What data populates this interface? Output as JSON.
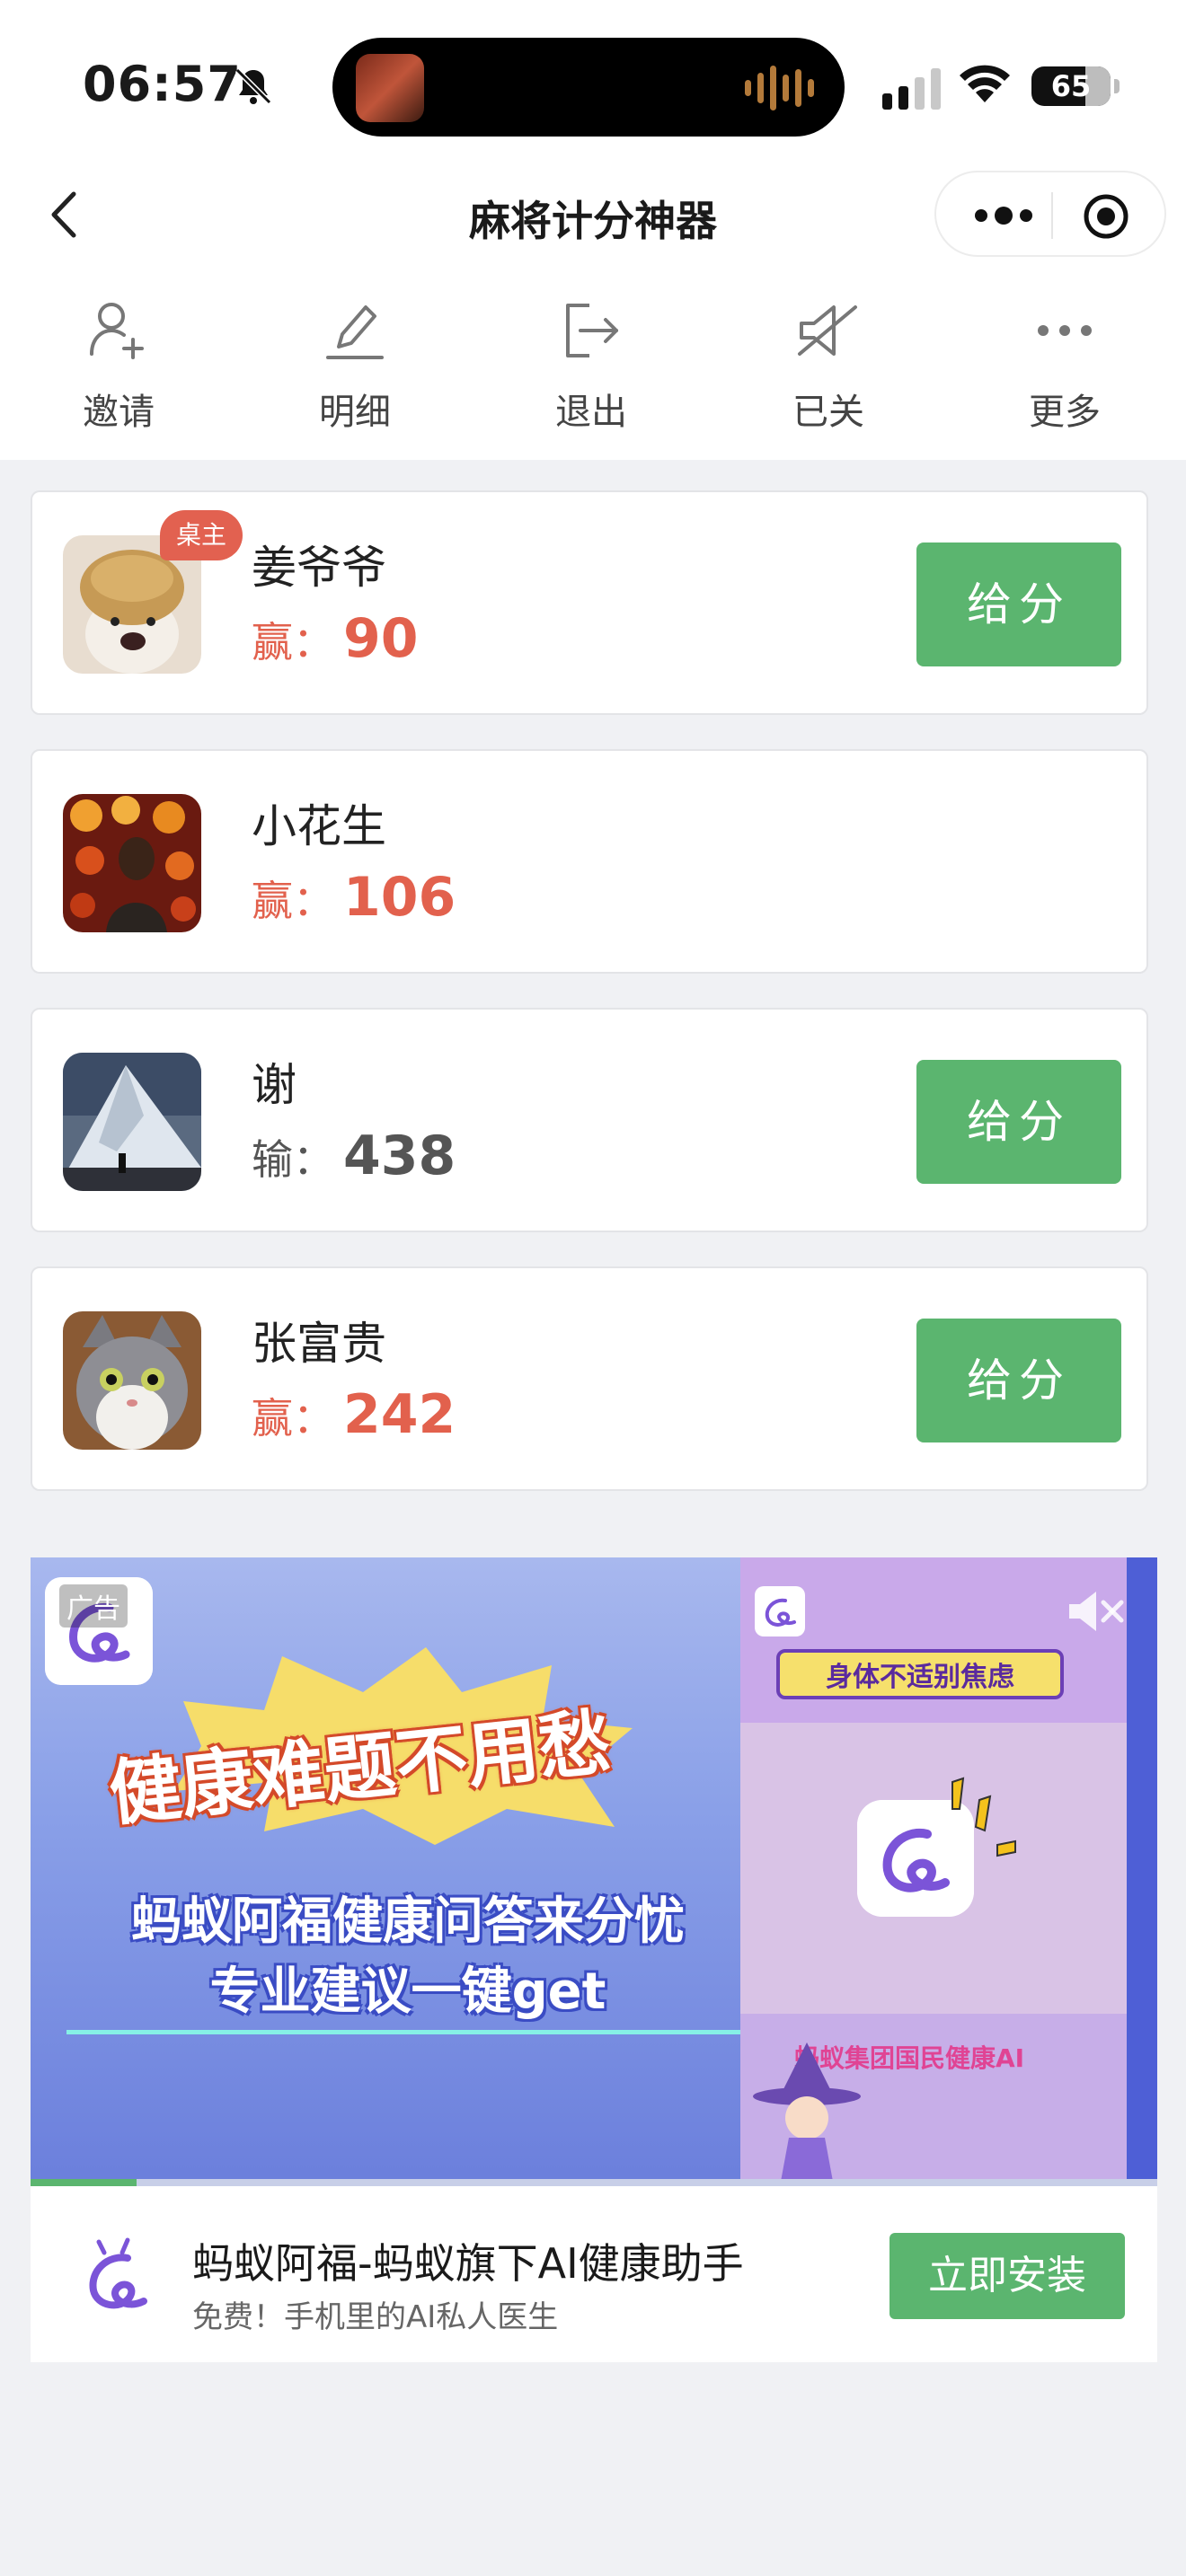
{
  "status_bar": {
    "time": "06:57",
    "battery": "65"
  },
  "nav": {
    "title": "麻将计分神器"
  },
  "toolbar": {
    "items": [
      {
        "label": "邀请",
        "icon": "add-user-icon"
      },
      {
        "label": "明细",
        "icon": "pencil-icon"
      },
      {
        "label": "退出",
        "icon": "exit-icon"
      },
      {
        "label": "已关",
        "icon": "speaker-muted-icon"
      },
      {
        "label": "更多",
        "icon": "more-icon"
      }
    ]
  },
  "players": [
    {
      "name": "姜爷爷",
      "result_label": "赢：",
      "score": "90",
      "status": "win",
      "badge": "桌主",
      "button": "给分"
    },
    {
      "name": "小花生",
      "result_label": "赢：",
      "score": "106",
      "status": "win",
      "badge": "",
      "button": ""
    },
    {
      "name": "谢",
      "result_label": "输：",
      "score": "438",
      "status": "lose",
      "badge": "",
      "button": "给分"
    },
    {
      "name": "张富贵",
      "result_label": "赢：",
      "score": "242",
      "status": "win",
      "badge": "",
      "button": "给分"
    }
  ],
  "ad": {
    "tag": "广告",
    "headline": "健康难题不用愁",
    "subline1": "蚂蚁阿福健康问答来分忧",
    "subline2": "专业建议一键get",
    "banner_tag": "身体不适别焦虑",
    "side_title": "蚂蚁集团国民健康AI",
    "progress": 0.094,
    "app_title": "蚂蚁阿福-蚂蚁旗下AI健康助手",
    "app_desc": "免费！手机里的AI私人医生",
    "install_label": "立即安装"
  },
  "colors": {
    "win": "#e2614d",
    "lose": "#555555",
    "button_green": "#5bb56f",
    "badge_red": "#e26150"
  }
}
